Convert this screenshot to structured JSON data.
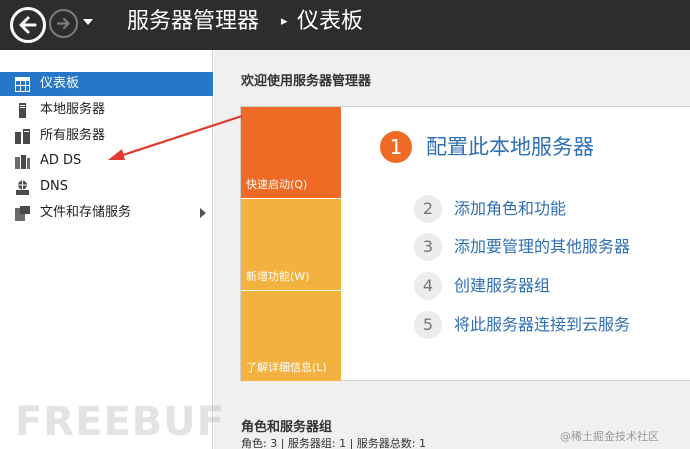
{
  "titlebar": {
    "app_title": "服务器管理器",
    "separator": "▸",
    "page_title": "仪表板"
  },
  "sidebar": {
    "items": [
      {
        "label": "仪表板",
        "icon": "dashboard-icon",
        "active": true
      },
      {
        "label": "本地服务器",
        "icon": "local-server-icon"
      },
      {
        "label": "所有服务器",
        "icon": "all-servers-icon"
      },
      {
        "label": "AD DS",
        "icon": "ad-ds-icon"
      },
      {
        "label": "DNS",
        "icon": "dns-icon"
      },
      {
        "label": "文件和存储服务",
        "icon": "file-storage-icon",
        "has_submenu": true
      }
    ]
  },
  "main": {
    "welcome_title": "欢迎使用服务器管理器",
    "tiles": {
      "quick_start": "快速启动(Q)",
      "whats_new": "新增功能(W)",
      "learn_more": "了解详细信息(L)"
    },
    "steps": [
      {
        "num": "1",
        "text": "配置此本地服务器"
      },
      {
        "num": "2",
        "text": "添加角色和功能"
      },
      {
        "num": "3",
        "text": "添加要管理的其他服务器"
      },
      {
        "num": "4",
        "text": "创建服务器组"
      },
      {
        "num": "5",
        "text": "将此服务器连接到云服务"
      }
    ],
    "roles_title": "角色和服务器组",
    "roles_stats": "角色: 3 | 服务器组: 1 | 服务器总数: 1"
  },
  "watermarks": {
    "freebuf": "FREEBUF",
    "juejin": "@稀土掘金技术社区"
  },
  "colors": {
    "titlebar_bg": "#2d2d30",
    "sidebar_active": "#2677c7",
    "tile_orange": "#ee6a25",
    "tile_yellow": "#f3b240",
    "link_blue": "#2e6fb5",
    "annotation_arrow": "#e23b2e"
  }
}
